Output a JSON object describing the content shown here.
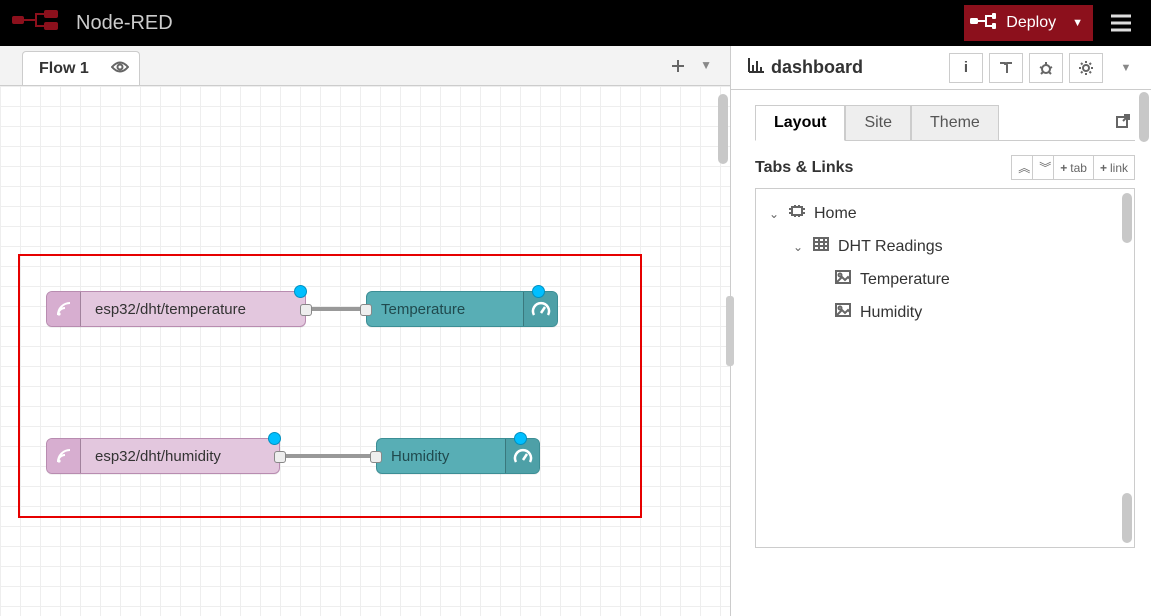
{
  "app": {
    "name": "Node-RED",
    "deploy_label": "Deploy"
  },
  "workspace": {
    "tab_label": "Flow 1",
    "nodes": {
      "mqtt_temp": "esp32/dht/temperature",
      "gauge_temp": "Temperature",
      "mqtt_hum": "esp32/dht/humidity",
      "gauge_hum": "Humidity"
    }
  },
  "sidebar": {
    "title": "dashboard",
    "tabs": {
      "layout": "Layout",
      "site": "Site",
      "theme": "Theme"
    },
    "section_title": "Tabs & Links",
    "buttons": {
      "add_tab": "tab",
      "add_link": "link"
    },
    "tree": {
      "home": "Home",
      "group": "DHT Readings",
      "widget_temp": "Temperature",
      "widget_hum": "Humidity"
    }
  }
}
